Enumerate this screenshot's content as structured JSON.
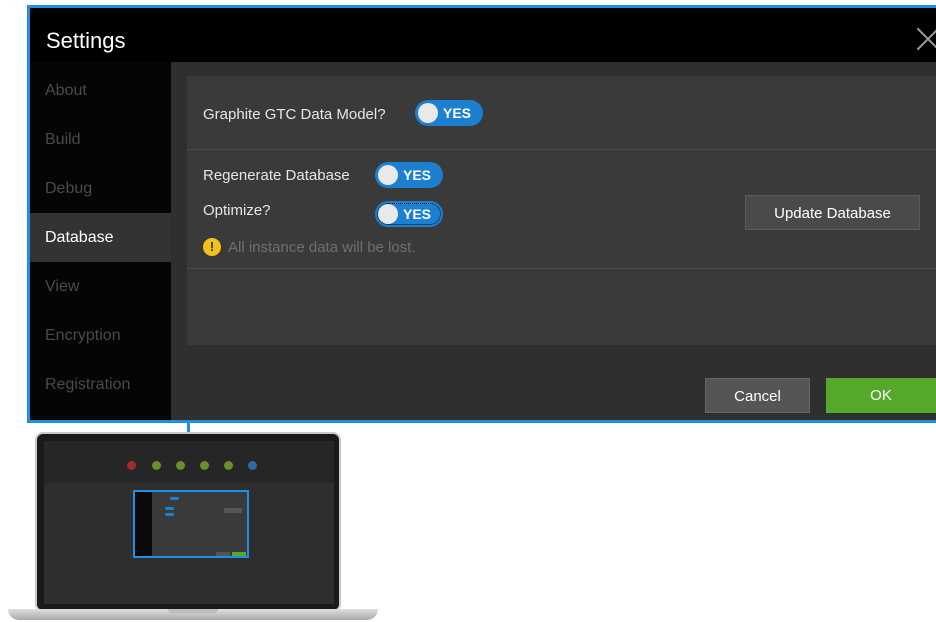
{
  "dialog": {
    "title": "Settings",
    "close_icon": "close-icon"
  },
  "sidebar": {
    "items": [
      {
        "label": "About",
        "active": false
      },
      {
        "label": "Build",
        "active": false
      },
      {
        "label": "Debug",
        "active": false
      },
      {
        "label": "Database",
        "active": true
      },
      {
        "label": "View",
        "active": false
      },
      {
        "label": "Encryption",
        "active": false
      },
      {
        "label": "Registration",
        "active": false
      }
    ]
  },
  "database": {
    "data_model_label": "Graphite GTC Data Model?",
    "data_model_toggle": "YES",
    "regenerate_label": "Regenerate Database",
    "regenerate_toggle": "YES",
    "optimize_label": "Optimize?",
    "optimize_toggle": "YES",
    "warning_icon": "warning-icon",
    "warning_text": "All instance data will be lost.",
    "update_button": "Update Database"
  },
  "footer": {
    "cancel_label": "Cancel",
    "ok_label": "OK"
  },
  "colors": {
    "accent": "#1f8fe6",
    "toggle": "#1d7fd0",
    "ok": "#55a82a",
    "warning": "#f2c21b"
  }
}
